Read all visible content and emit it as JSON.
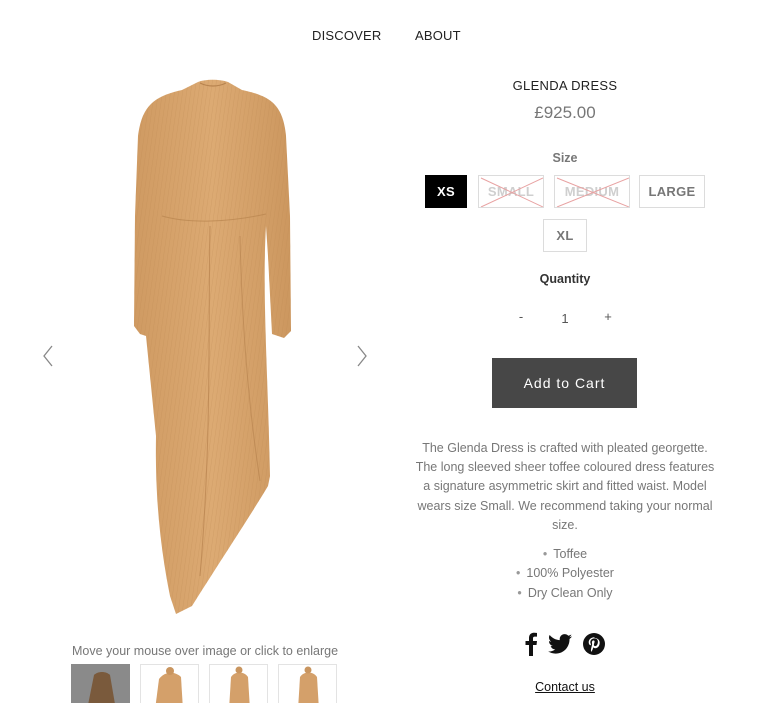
{
  "nav": {
    "items": [
      {
        "label": "DISCOVER"
      },
      {
        "label": "ABOUT"
      }
    ]
  },
  "gallery": {
    "enlarge_hint": "Move your mouse over image or click to enlarge",
    "prev_icon": "chevron-left-icon",
    "next_icon": "chevron-right-icon",
    "thumbnail_count": 4,
    "active_thumbnail": 1
  },
  "product": {
    "title": "GLENDA DRESS",
    "price": "£925.00",
    "size_label": "Size",
    "sizes": [
      {
        "label": "XS",
        "state": "selected"
      },
      {
        "label": "SMALL",
        "state": "unavailable"
      },
      {
        "label": "MEDIUM",
        "state": "unavailable"
      },
      {
        "label": "LARGE",
        "state": "available"
      },
      {
        "label": "XL",
        "state": "available"
      }
    ],
    "quantity_label": "Quantity",
    "quantity_minus": "-",
    "quantity_value": "1",
    "quantity_plus": "+",
    "add_to_cart": "Add to Cart",
    "description": "The Glenda Dress is crafted with pleated georgette. The long sleeved sheer toffee coloured dress features a signature asymmetric skirt and fitted waist.  Model wears size Small. We recommend taking your normal size.",
    "details": [
      "Toffee",
      "100% Polyester",
      "Dry Clean Only"
    ]
  },
  "social": {
    "icons": [
      "facebook-icon",
      "twitter-icon",
      "pinterest-icon"
    ]
  },
  "footer": {
    "contact": "Contact us"
  },
  "colors": {
    "dress": "#d8a56d",
    "cart_button": "#474747",
    "selected_size": "#000000",
    "cross_out": "#e8a2a2"
  }
}
